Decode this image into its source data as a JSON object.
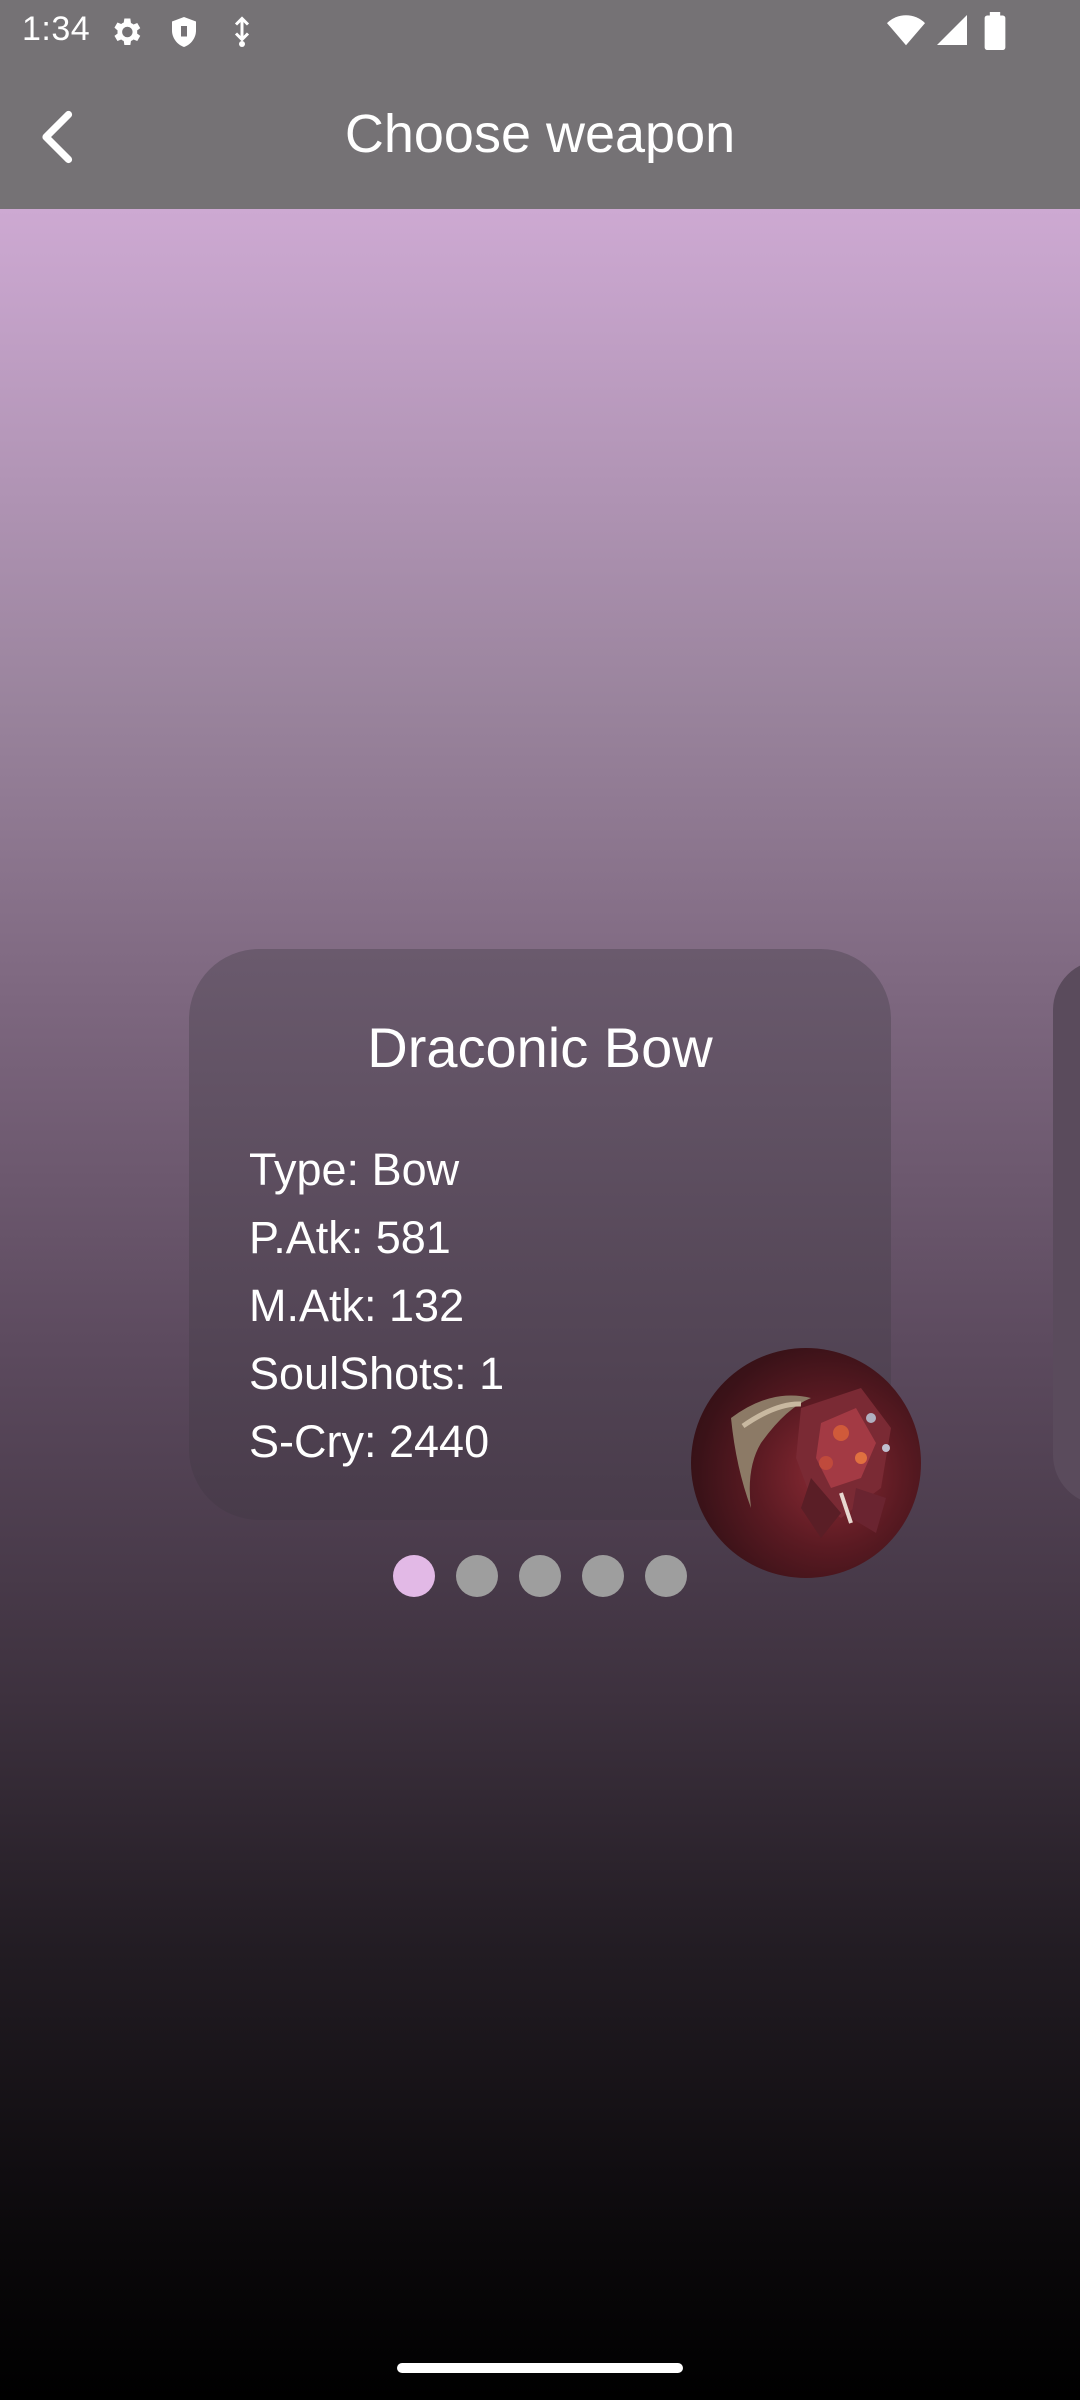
{
  "status_bar": {
    "time": "1:34",
    "left_icons": [
      "gear-icon",
      "shield-icon",
      "usb-icon"
    ],
    "right_icons": [
      "wifi-icon",
      "signal-icon",
      "battery-icon"
    ]
  },
  "app_bar": {
    "title": "Choose weapon",
    "back_icon": "chevron-left-icon"
  },
  "card": {
    "name": "Draconic Bow",
    "stats": [
      "Type: Bow",
      "P.Atk: 581",
      "M.Atk: 132",
      "SoulShots: 1",
      "S-Cry: 2440"
    ],
    "image_icon": "draconic-bow-image"
  },
  "pager": {
    "count": 5,
    "active_index": 0,
    "active_color": "#e2b9e6",
    "inactive_color": "#9e9e9e"
  },
  "colors": {
    "bar_background": "#757275",
    "gradient_top": "#e2b9e6",
    "gradient_bottom": "#000000"
  }
}
